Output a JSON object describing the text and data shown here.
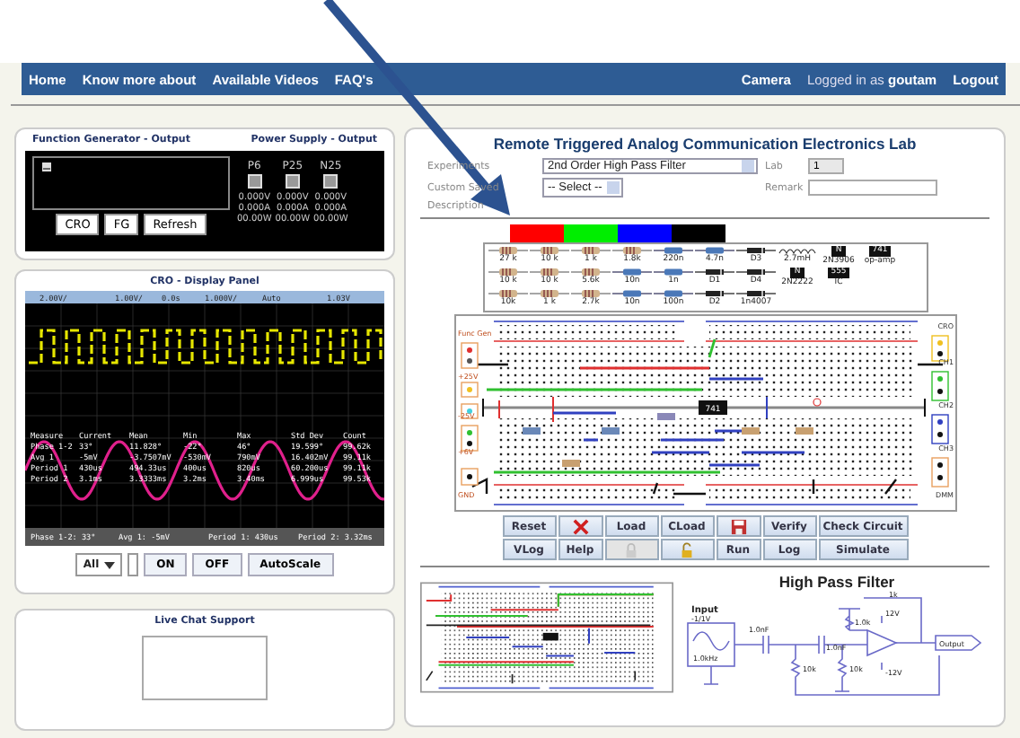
{
  "nav": {
    "links": [
      "Home",
      "Know more about",
      "Available Videos",
      "FAQ's"
    ],
    "camera": "Camera",
    "logged_in": "Logged in as **goutam**",
    "logout": "Logout"
  },
  "function_generator": {
    "title": "Function Generator - Output",
    "buttons": [
      "CRO",
      "FG",
      "Refresh"
    ]
  },
  "power_supply": {
    "title": "Power Supply - Output",
    "outputs": [
      {
        "name": "P6",
        "on": false,
        "voltage": "0.000V",
        "current": "0.000A",
        "power": "00.00W"
      },
      {
        "name": "P25",
        "on": false,
        "voltage": "0.000V",
        "current": "0.000A",
        "power": "00.00W"
      },
      {
        "name": "N25",
        "on": false,
        "voltage": "0.000V",
        "current": "0.000A",
        "power": "00.00W"
      }
    ]
  },
  "cro": {
    "title": "CRO - Display Panel",
    "readouts": [
      "2.00V/",
      "1.00V/",
      "0.0s",
      "1.000V/",
      "Auto",
      "1.03V"
    ],
    "measure_columns": [
      "Measure",
      "Current",
      "Mean",
      "Min",
      "Max",
      "Std Dev",
      "Count"
    ],
    "measure_rows": [
      [
        "Phase 1-2",
        "33°",
        "11.828°",
        "-22°",
        "46°",
        "19.599°",
        "99.62k"
      ],
      [
        "Avg 1",
        "-5mV",
        "-3.7507mV",
        "-530mV",
        "790mV",
        "16.402mV",
        "99.11k"
      ],
      [
        "Period 1",
        "430us",
        "494.33us",
        "400us",
        "820us",
        "60.200us",
        "99.11k"
      ],
      [
        "Period 2",
        "3.1ms",
        "3.3333ms",
        "3.2ms",
        "3.40ms",
        "6.999us",
        "99.53k"
      ]
    ],
    "status": [
      "Phase 1-2: 33°",
      "Avg 1: -5mV",
      "Period 1: 430us",
      "Period 2: 3.32ms"
    ],
    "channel": "All",
    "buttons": [
      "ON",
      "OFF",
      "AutoScale"
    ]
  },
  "chat": {
    "title": "Live Chat Support"
  },
  "lab": {
    "title": "Remote Triggered Analog Communication Electronics Lab",
    "experiments_label": "Experiments",
    "experiment": "2nd Order High Pass Filter",
    "lab_label": "Lab",
    "lab_value": "1",
    "custom_label": "Custom Saved",
    "custom_value": "-- Select --",
    "remark_label": "Remark",
    "description_label": "Description",
    "colors": [
      {
        "color": "#ff0000"
      },
      {
        "color": "#00ee00"
      },
      {
        "color": "#0000ff"
      },
      {
        "color": "#000000"
      }
    ],
    "components": [
      [
        {
          "kind": "resistor",
          "label": "27 k"
        },
        {
          "kind": "resistor",
          "label": "10 k"
        },
        {
          "kind": "resistor",
          "label": "1 k"
        },
        {
          "kind": "resistor",
          "label": "1.8k"
        },
        {
          "kind": "capacitor",
          "label": "220n"
        },
        {
          "kind": "capacitor",
          "label": "4.7n"
        },
        {
          "kind": "diode",
          "label": "D3"
        },
        {
          "kind": "inductor",
          "label": "2.7mH"
        },
        {
          "kind": "transistor",
          "label": "2N3906",
          "chip": "N"
        },
        {
          "kind": "ic",
          "label": "op-amp",
          "chip": "741"
        }
      ],
      [
        {
          "kind": "resistor",
          "label": "10 k"
        },
        {
          "kind": "resistor",
          "label": "10 k"
        },
        {
          "kind": "resistor",
          "label": "5.6k"
        },
        {
          "kind": "capacitor",
          "label": "10n"
        },
        {
          "kind": "capacitor",
          "label": "1n"
        },
        {
          "kind": "diode",
          "label": "D1"
        },
        {
          "kind": "diode",
          "label": "D4"
        },
        {
          "kind": "transistor",
          "label": "2N2222",
          "chip": "N"
        },
        {
          "kind": "ic",
          "label": "IC",
          "chip": "555"
        }
      ],
      [
        {
          "kind": "resistor",
          "label": "10k"
        },
        {
          "kind": "resistor",
          "label": "1 k"
        },
        {
          "kind": "resistor",
          "label": "2.7k"
        },
        {
          "kind": "capacitor",
          "label": "10n"
        },
        {
          "kind": "capacitor",
          "label": "100n"
        },
        {
          "kind": "diode",
          "label": "D2"
        },
        {
          "kind": "diode",
          "label": "1n4007"
        }
      ]
    ],
    "breadboard": {
      "left_labels": [
        "Func Gen",
        "+25V",
        "-25V",
        "+6V",
        "GND"
      ],
      "right_labels": [
        "CRO",
        "CH1",
        "CH2",
        "CH3",
        "DMM"
      ],
      "chip": "741"
    },
    "toolbar": [
      {
        "kind": "text",
        "label": "Reset",
        "disabled": false
      },
      {
        "kind": "delete",
        "disabled": false
      },
      {
        "kind": "text",
        "label": "Load",
        "disabled": false
      },
      {
        "kind": "text",
        "label": "CLoad",
        "disabled": false
      },
      {
        "kind": "save",
        "disabled": false
      },
      {
        "kind": "text",
        "label": "Verify",
        "disabled": false
      },
      {
        "kind": "text",
        "label": "Check Circuit",
        "disabled": false
      },
      {
        "kind": "text",
        "label": "VLog",
        "disabled": false
      },
      {
        "kind": "text",
        "label": "Help",
        "disabled": false
      },
      {
        "kind": "lock",
        "disabled": true
      },
      {
        "kind": "unlock",
        "disabled": false
      },
      {
        "kind": "text",
        "label": "Run",
        "disabled": false
      },
      {
        "kind": "text",
        "label": "Log",
        "disabled": false
      },
      {
        "kind": "text",
        "label": "Simulate",
        "disabled": false
      }
    ],
    "circuit_title": "High Pass Filter",
    "schematic": {
      "input": "Input",
      "amplitude": "-1/1V",
      "frequency": "1.0kHz",
      "c1": "1.0nF",
      "c2": "1.0nF",
      "r1": "10k",
      "r2": "10k",
      "rf1": "1k",
      "rf2": "1.0k",
      "vpos": "12V",
      "vneg": "-12V",
      "output": "Output"
    }
  }
}
